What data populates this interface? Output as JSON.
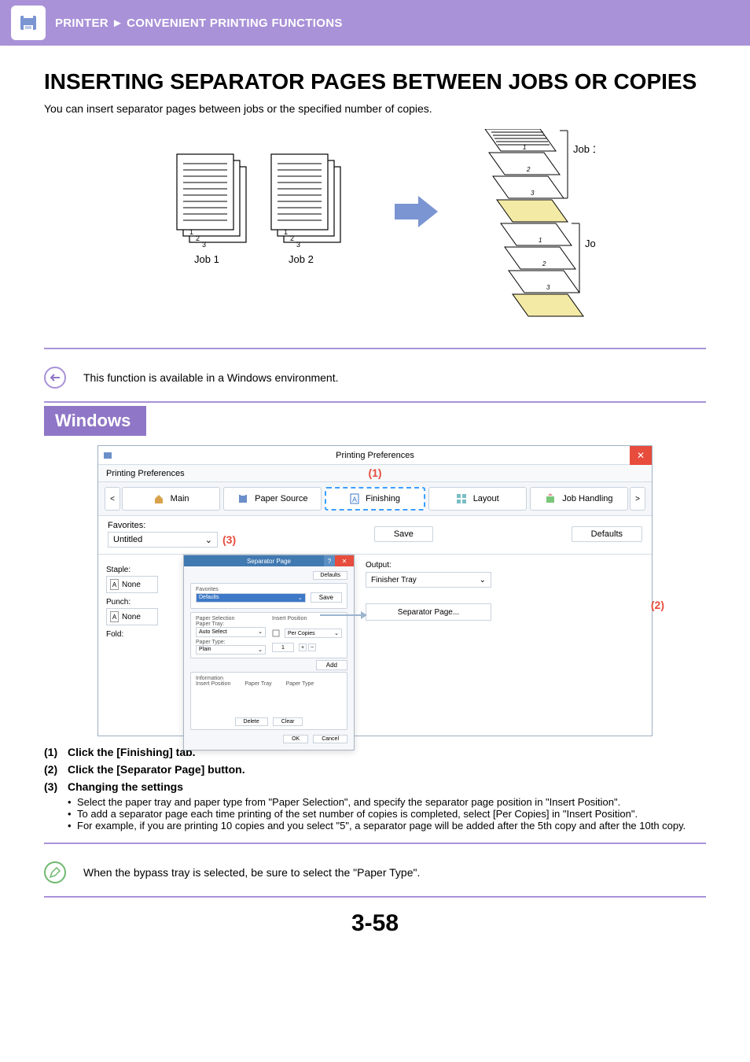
{
  "header": {
    "section": "PRINTER",
    "arrow": "►",
    "subsection": "CONVENIENT PRINTING FUNCTIONS"
  },
  "title": "INSERTING SEPARATOR PAGES BETWEEN JOBS OR COPIES",
  "intro": "You can insert separator pages between jobs or the specified number of copies.",
  "illus_labels": {
    "job1": "Job 1",
    "job2": "Job 2"
  },
  "note1": "This function is available in a Windows environment.",
  "section": "Windows",
  "screenshot": {
    "window_title": "Printing Preferences",
    "row2": "Printing Preferences",
    "tabs": [
      "Main",
      "Paper Source",
      "Finishing",
      "Layout",
      "Job Handling"
    ],
    "favorites_label": "Favorites:",
    "favorites_value": "Untitled",
    "save": "Save",
    "defaults": "Defaults",
    "left": {
      "staple": "Staple:",
      "none": "None",
      "punch": "Punch:",
      "fold": "Fold:"
    },
    "right": {
      "output": "Output:",
      "output_value": "Finisher Tray",
      "sep_btn": "Separator Page..."
    },
    "callouts": {
      "c1": "(1)",
      "c2": "(2)",
      "c3": "(3)"
    },
    "sep_dialog": {
      "title": "Separator Page",
      "defaults": "Defaults",
      "favorites": "Favorites",
      "fav_value": "Defaults",
      "save": "Save",
      "paper_selection": "Paper Selection",
      "paper_tray": "Paper Tray:",
      "paper_tray_val": "Auto Select",
      "insert_position": "Insert Position",
      "per_copies": "Per Copies",
      "count": "1",
      "paper_type": "Paper Type:",
      "paper_type_val": "Plain",
      "add": "Add",
      "information": "Information",
      "col1": "Insert Position",
      "col2": "Paper Tray",
      "col3": "Paper Type",
      "delete": "Delete",
      "clear": "Clear",
      "ok": "OK",
      "cancel": "Cancel"
    }
  },
  "steps": [
    {
      "num": "(1)",
      "title": "Click the [Finishing] tab."
    },
    {
      "num": "(2)",
      "title": "Click the [Separator Page] button."
    },
    {
      "num": "(3)",
      "title": "Changing the settings",
      "sub": [
        "Select the paper tray and paper type from \"Paper Selection\", and specify the separator page position in \"Insert Position\".",
        "To add a separator page each time printing of the set number of copies is completed, select [Per Copies] in \"Insert Position\".",
        "For example, if you are printing 10 copies and you select \"5\", a separator page will be added after the 5th copy and after the 10th copy."
      ]
    }
  ],
  "note2": "When the bypass tray is selected, be sure to select the \"Paper Type\".",
  "pagenum": "3-58"
}
